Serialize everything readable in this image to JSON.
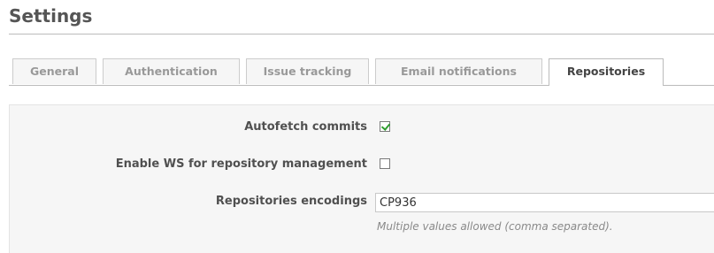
{
  "page": {
    "title": "Settings"
  },
  "tabs": [
    {
      "label": "General",
      "selected": false
    },
    {
      "label": "Authentication",
      "selected": false
    },
    {
      "label": "Issue tracking",
      "selected": false
    },
    {
      "label": "Email notifications",
      "selected": false
    },
    {
      "label": "Repositories",
      "selected": true
    }
  ],
  "form": {
    "autofetch": {
      "label": "Autofetch commits",
      "checked": true
    },
    "enable_ws": {
      "label": "Enable WS for repository management",
      "checked": false
    },
    "encodings": {
      "label": "Repositories encodings",
      "value": "CP936",
      "hint": "Multiple values allowed (comma separated)."
    }
  },
  "colors": {
    "checkmark": "#2f9e2f",
    "panel_background": "#f6f6f6",
    "rule": "#bbbbbb"
  }
}
